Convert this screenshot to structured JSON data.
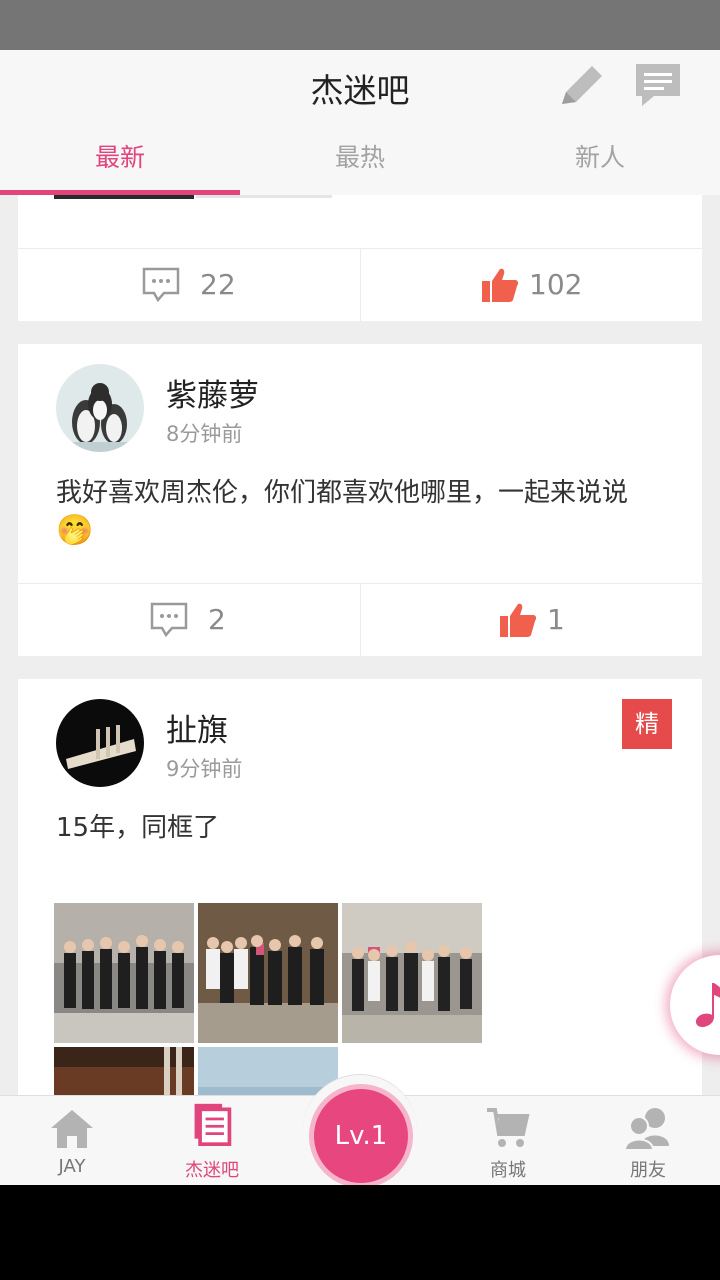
{
  "app": {
    "title": "杰迷吧"
  },
  "tabs": [
    {
      "label": "最新",
      "active": true
    },
    {
      "label": "最热",
      "active": false
    },
    {
      "label": "新人",
      "active": false
    }
  ],
  "posts": [
    {
      "comments": "22",
      "likes": "102"
    },
    {
      "username": "紫藤萝",
      "time": "8分钟前",
      "text": "我好喜欢周杰伦，你们都喜欢他哪里，一起来说说",
      "emoji": "🤭",
      "comments": "2",
      "likes": "1"
    },
    {
      "username": "扯旗",
      "time": "9分钟前",
      "badge": "精",
      "text": "15年，同框了",
      "photo_count": 5
    }
  ],
  "bottom_nav": [
    {
      "label": "JAY",
      "icon": "home-icon",
      "active": false
    },
    {
      "label": "杰迷吧",
      "icon": "posts-icon",
      "active": true
    },
    {
      "label": "商城",
      "icon": "cart-icon",
      "active": false
    },
    {
      "label": "朋友",
      "icon": "friends-icon",
      "active": false
    }
  ],
  "level": {
    "label": "Lv.1"
  },
  "colors": {
    "accent": "#e0457d",
    "badge": "#e54b4b",
    "like": "#f0604d"
  }
}
